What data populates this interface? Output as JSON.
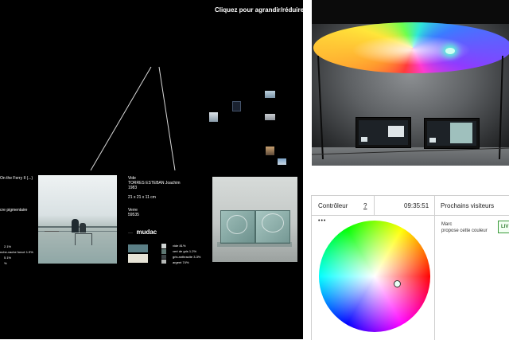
{
  "collection_view": {
    "toggle_hint": "Cliquez pour agrandir/réduire",
    "left_artwork": {
      "title_partial": "On the Ferry II (...)",
      "process_partial": "cre pigmentaire",
      "color_breakdown": [
        "2.1%",
        "nche-vache foncé 1.9%",
        "5.1%",
        "%"
      ]
    },
    "selected_artwork": {
      "type": "Vide",
      "artist": "TORRES ESTEBAN Joachim",
      "year": "1983",
      "dimensions": "21 x 21 x 11 cm",
      "category_label": "Verre",
      "inventory": "59535",
      "museum_logo": "mudac",
      "color_breakdown": [
        "vide 81%",
        "vert de gris 1.2%",
        "gris anthracite 3.3%",
        "argent 74%"
      ]
    }
  },
  "control_panel": {
    "controller_label": "Contrôleur",
    "help_label": "?",
    "time": "09:35:51",
    "next_visitors_label": "Prochains visiteurs",
    "visitor_name": "Marc",
    "visitor_action": "propose cette couleur",
    "live_badge": "LIV",
    "menu_dots": "•••"
  },
  "colors": {
    "accent_green": "#3a9a3a",
    "panel_border": "#cfcfcf"
  }
}
